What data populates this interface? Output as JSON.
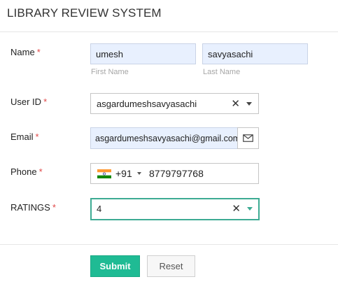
{
  "header": {
    "title": "LIBRARY REVIEW SYSTEM"
  },
  "form": {
    "name": {
      "label": "Name",
      "required_mark": "*",
      "first_value": "umesh",
      "first_sublabel": "First Name",
      "last_value": "savyasachi",
      "last_sublabel": "Last Name"
    },
    "user_id": {
      "label": "User ID",
      "required_mark": "*",
      "value": "asgardumeshsavyasachi",
      "clear_glyph": "✕"
    },
    "email": {
      "label": "Email",
      "required_mark": "*",
      "value": "asgardumeshsavyasachi@gmail.com",
      "button_icon": "envelope-icon"
    },
    "phone": {
      "label": "Phone",
      "required_mark": "*",
      "country_flag": "india-flag-icon",
      "country_code": "+91",
      "number": "8779797768"
    },
    "ratings": {
      "label": "RATINGS",
      "required_mark": "*",
      "value": "4",
      "clear_glyph": "✕"
    }
  },
  "actions": {
    "submit_label": "Submit",
    "reset_label": "Reset"
  },
  "colors": {
    "required": "#e04848",
    "autofill_bg": "#e8f0fe",
    "accent_green": "#1fbb94",
    "focus_border": "#3dab93"
  }
}
